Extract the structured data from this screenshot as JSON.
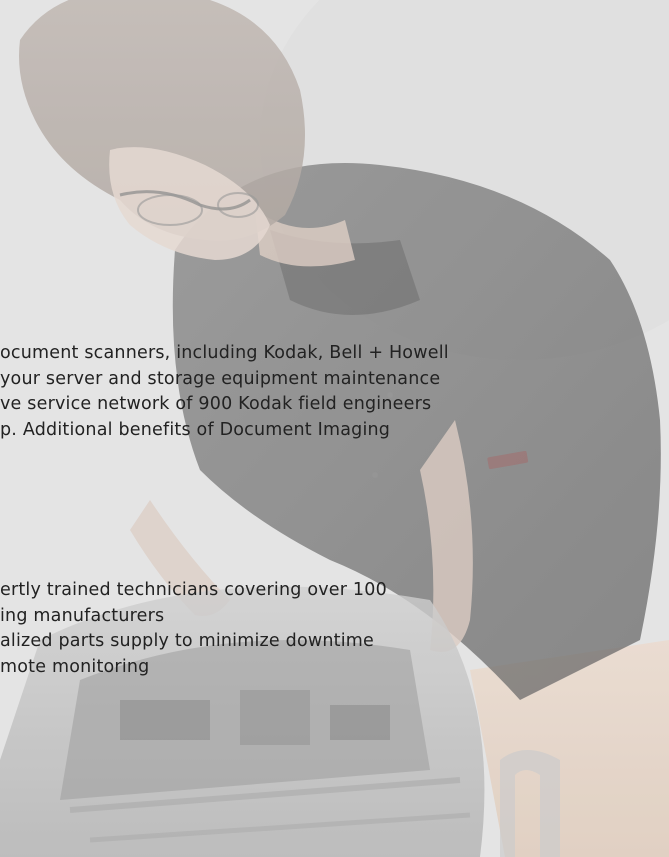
{
  "body": {
    "paragraph_lines": [
      "ocument scanners, including Kodak, Bell + Howell",
      " your server and storage equipment maintenance",
      "ve service network of 900 Kodak field engineers",
      "p. Additional benefits of Document Imaging"
    ],
    "bullet_lines": [
      "ertly trained technicians covering over 100",
      "ing manufacturers",
      "alized parts supply to minimize downtime",
      "mote monitoring"
    ]
  },
  "colors": {
    "text": "#222222",
    "shirt": "#3a3a3a",
    "background": "#e0e0e0"
  }
}
